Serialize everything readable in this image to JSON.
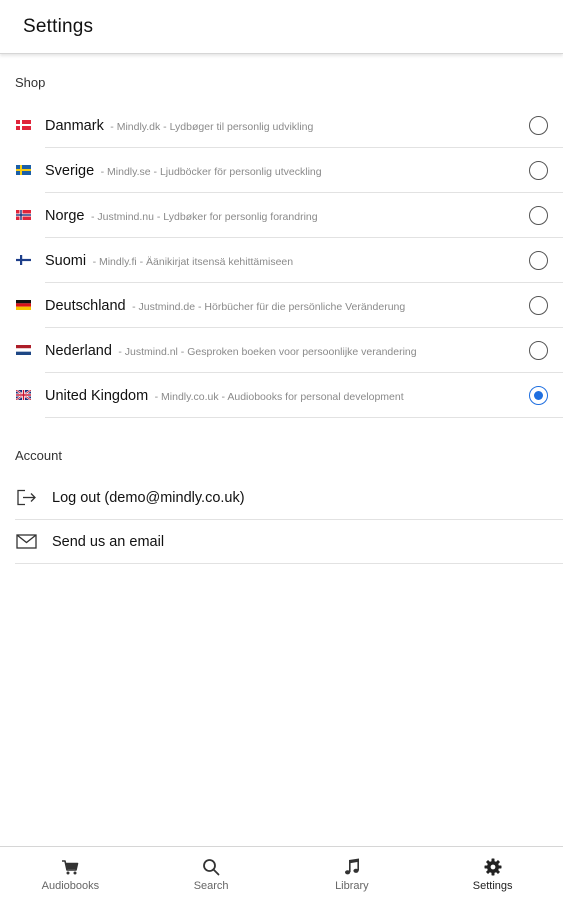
{
  "header": {
    "title": "Settings"
  },
  "shop": {
    "section_label": "Shop",
    "items": [
      {
        "name": "Danmark",
        "desc": "- Mindly.dk - Lydbøger til personlig udvikling",
        "flag": "denmark-flag",
        "selected": false
      },
      {
        "name": "Sverige",
        "desc": "- Mindly.se - Ljudböcker för personlig utveckling",
        "flag": "sweden-flag",
        "selected": false
      },
      {
        "name": "Norge",
        "desc": "- Justmind.nu - Lydbøker for personlig forandring",
        "flag": "norway-flag",
        "selected": false
      },
      {
        "name": "Suomi",
        "desc": "- Mindly.fi - Äänikirjat itsensä kehittämiseen",
        "flag": "finland-flag",
        "selected": false
      },
      {
        "name": "Deutschland",
        "desc": "- Justmind.de - Hörbücher für die persönliche Veränderung",
        "flag": "germany-flag",
        "selected": false
      },
      {
        "name": "Nederland",
        "desc": "- Justmind.nl - Gesproken boeken voor persoonlijke verandering",
        "flag": "netherlands-flag",
        "selected": false
      },
      {
        "name": "United Kingdom",
        "desc": "- Mindly.co.uk - Audiobooks for personal development",
        "flag": "uk-flag",
        "selected": true
      }
    ]
  },
  "account": {
    "section_label": "Account",
    "items": [
      {
        "label": "Log out (demo@mindly.co.uk)",
        "icon": "logout-icon"
      },
      {
        "label": "Send us an email",
        "icon": "mail-icon"
      }
    ]
  },
  "tabs": [
    {
      "label": "Audiobooks",
      "icon": "cart-icon",
      "active": false
    },
    {
      "label": "Search",
      "icon": "search-icon",
      "active": false
    },
    {
      "label": "Library",
      "icon": "music-note-icon",
      "active": false
    },
    {
      "label": "Settings",
      "icon": "gear-icon",
      "active": true
    }
  ],
  "colors": {
    "accent": "#1f6fe0",
    "divider": "#e2e2e2",
    "muted_text": "#8a8a8a"
  }
}
